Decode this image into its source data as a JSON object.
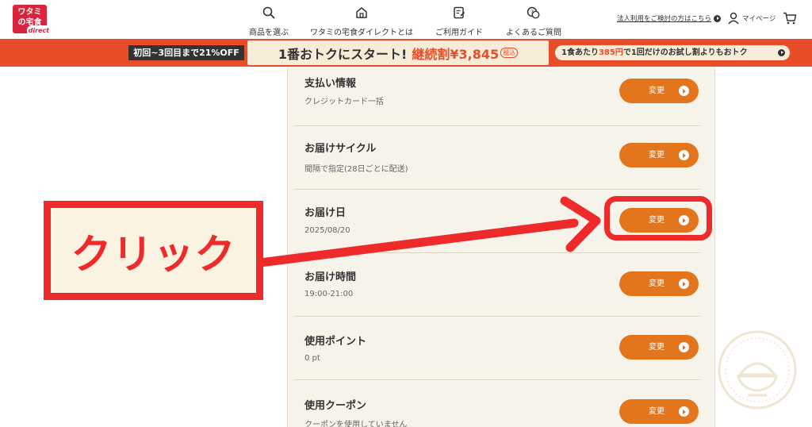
{
  "header": {
    "logo": {
      "line1": "ワタミ",
      "line2": "の宅食",
      "sub": "direct"
    },
    "nav": [
      {
        "label": "商品を選ぶ",
        "icon": "search-icon"
      },
      {
        "label": "ワタミの宅食ダイレクトとは",
        "icon": "home-icon"
      },
      {
        "label": "ご利用ガイド",
        "icon": "guide-icon"
      },
      {
        "label": "よくあるご質問",
        "icon": "faq-icon"
      }
    ],
    "corporate_link": "法人利用をご検討の方はこちら",
    "mypage": "マイページ",
    "cart_icon": "cart-icon"
  },
  "banner": {
    "left": "初回~3回目まで21%OFF",
    "center_main": "1番おトクにスタート!",
    "center_price": "継続割¥3,845",
    "center_tax": "税込",
    "right_pre": "1食あたり",
    "right_hl": "385円",
    "right_post": "で1回だけのお試し割よりもおトク"
  },
  "settings": [
    {
      "title": "支払い情報",
      "value": "クレジットカード一括",
      "button": "変更"
    },
    {
      "title": "お届けサイクル",
      "value": "間隔で指定(28日ごとに配送)",
      "button": "変更"
    },
    {
      "title": "お届け日",
      "value": "2025/08/20",
      "button": "変更"
    },
    {
      "title": "お届け時間",
      "value": "19:00-21:00",
      "button": "変更"
    },
    {
      "title": "使用ポイント",
      "value": "0 pt",
      "button": "変更"
    },
    {
      "title": "使用クーポン",
      "value": "クーポンを使用していません",
      "button": "変更"
    }
  ],
  "annotation": {
    "label": "クリック",
    "color": "#ee2a2a"
  },
  "colors": {
    "accent": "#e3761d",
    "banner": "#e84d2a",
    "brand": "#d8243c",
    "panel": "#f6f3ea"
  }
}
